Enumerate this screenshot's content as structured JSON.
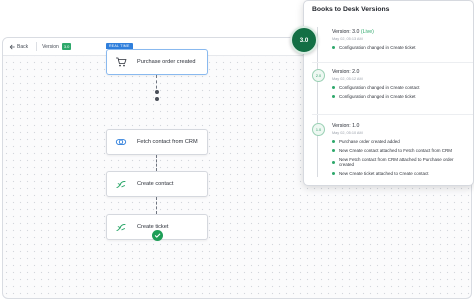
{
  "topbar": {
    "back_label": "Back",
    "version_label": "Version",
    "version_value": "3.0"
  },
  "workflow": {
    "realtime_badge": "REAL TIME",
    "nodes": [
      {
        "label": "Purchase order created",
        "icon": "cart-icon"
      },
      {
        "label": "Fetch contact from CRM",
        "icon": "crm-sync-icon"
      },
      {
        "label": "Create contact",
        "icon": "desk-action-icon"
      },
      {
        "label": "Create ticket",
        "icon": "desk-action-icon"
      }
    ],
    "end_icon": "check-circle-icon"
  },
  "versions_panel": {
    "title": "Books to Desk Versions",
    "current_badge": "3.0",
    "versions": [
      {
        "badge": "3.0",
        "title": "Version: 3.0",
        "live": "(Live)",
        "date": "May 02, 05:13 AM",
        "changes": [
          "Configuration changed in Create ticket"
        ]
      },
      {
        "badge": "2.0",
        "title": "Version: 2.0",
        "live": "",
        "date": "May 02, 05:12 AM",
        "changes": [
          "Configuration changed in Create contact",
          "Configuration changed in Create ticket"
        ]
      },
      {
        "badge": "1.0",
        "title": "Version: 1.0",
        "live": "",
        "date": "May 02, 05:10 AM",
        "changes": [
          "Purchase order created added",
          "New Create contact attached to Fetch contact from CRM",
          "New Fetch contact from CRM attached to Purchase order created",
          "New Create ticket attached to Create contact"
        ]
      }
    ]
  },
  "colors": {
    "accent_green": "#2ea86b",
    "badge_dark_green": "#136f44",
    "realtime_blue": "#2f7fdc"
  }
}
